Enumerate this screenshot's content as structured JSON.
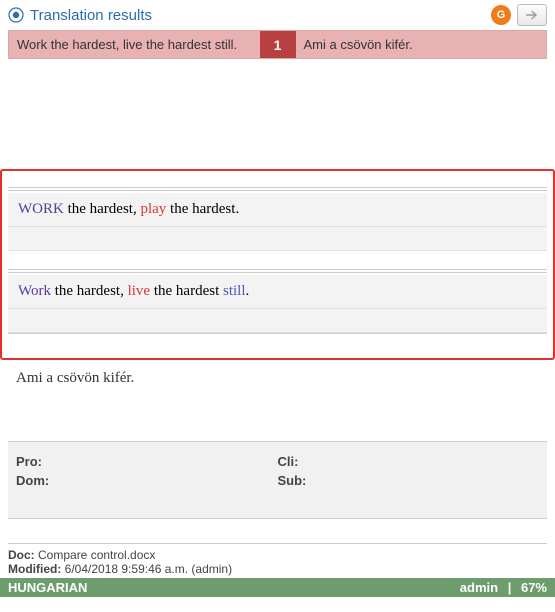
{
  "header": {
    "title": "Translation results",
    "orange_button_label": "G"
  },
  "translation_row": {
    "source": "Work the hardest, live the hardest still.",
    "index": "1",
    "target": "Ami a csövön kifér."
  },
  "comparison": {
    "variant1": {
      "w1": "WORK",
      "w2": " the hardest, ",
      "w3": "play",
      "w4": " the hardest."
    },
    "variant2": {
      "w1": "Work",
      "w2": " the hardest, ",
      "w3": "live",
      "w4": " the hardest ",
      "w5": "still",
      "w6": "."
    }
  },
  "target_segment": "Ami a csövön kifér.",
  "meta": {
    "pro_label": "Pro:",
    "pro_value": "",
    "cli_label": "Cli:",
    "cli_value": "",
    "dom_label": "Dom:",
    "dom_value": "",
    "sub_label": "Sub:",
    "sub_value": ""
  },
  "doc": {
    "doc_label": "Doc:",
    "doc_value": " Compare control.docx",
    "mod_label": "Modified:",
    "mod_value": " 6/04/2018 9:59:46 a.m. (admin)"
  },
  "status": {
    "language": "HUNGARIAN",
    "user": "admin",
    "sep": " | ",
    "percent": "67%"
  }
}
